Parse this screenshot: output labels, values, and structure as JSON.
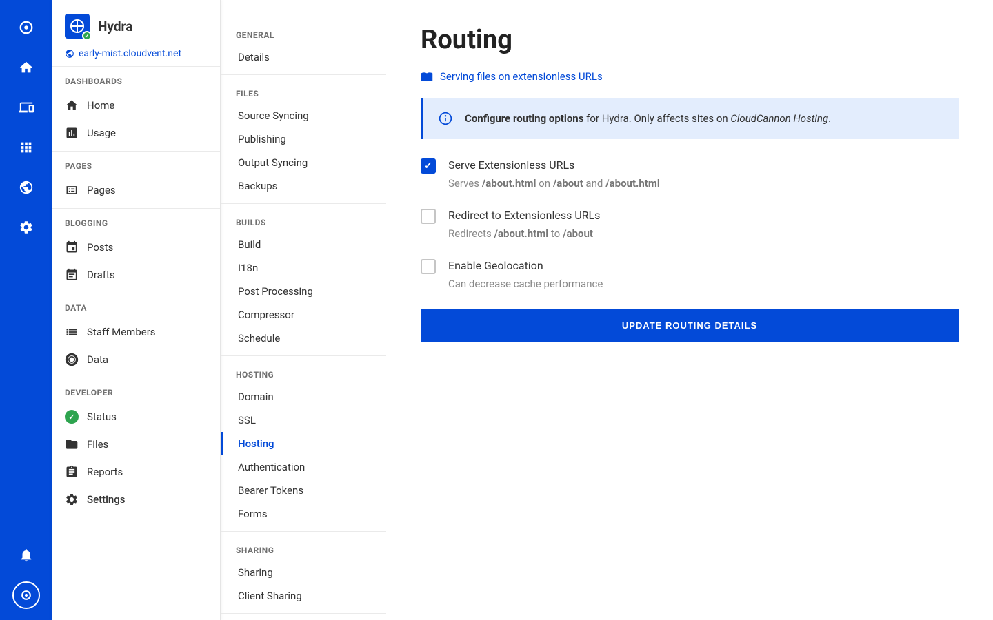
{
  "site": {
    "name": "Hydra",
    "url": "early-mist.cloudvent.net"
  },
  "sidebar": {
    "sections": [
      {
        "header": "DASHBOARDS",
        "items": [
          {
            "label": "Home",
            "icon": "home"
          },
          {
            "label": "Usage",
            "icon": "chart"
          }
        ]
      },
      {
        "header": "PAGES",
        "items": [
          {
            "label": "Pages",
            "icon": "page"
          }
        ]
      },
      {
        "header": "BLOGGING",
        "items": [
          {
            "label": "Posts",
            "icon": "event"
          },
          {
            "label": "Drafts",
            "icon": "event-draft"
          }
        ]
      },
      {
        "header": "DATA",
        "items": [
          {
            "label": "Staff Members",
            "icon": "list"
          },
          {
            "label": "Data",
            "icon": "donut"
          }
        ]
      },
      {
        "header": "DEVELOPER",
        "items": [
          {
            "label": "Status",
            "icon": "status"
          },
          {
            "label": "Files",
            "icon": "folder"
          },
          {
            "label": "Reports",
            "icon": "clipboard"
          },
          {
            "label": "Settings",
            "icon": "gear",
            "active": true
          }
        ]
      }
    ]
  },
  "settings_nav": {
    "groups": [
      {
        "header": "GENERAL",
        "items": [
          "Details"
        ]
      },
      {
        "header": "FILES",
        "items": [
          "Source Syncing",
          "Publishing",
          "Output Syncing",
          "Backups"
        ]
      },
      {
        "header": "BUILDS",
        "items": [
          "Build",
          "I18n",
          "Post Processing",
          "Compressor",
          "Schedule"
        ]
      },
      {
        "header": "HOSTING",
        "items": [
          "Domain",
          "SSL",
          "Hosting",
          "Authentication",
          "Bearer Tokens",
          "Forms"
        ],
        "active": "Hosting"
      },
      {
        "header": "SHARING",
        "items": [
          "Sharing",
          "Client Sharing"
        ]
      }
    ]
  },
  "page": {
    "title": "Routing",
    "doc_link": "Serving files on extensionless URLs",
    "info": {
      "bold": "Configure routing options",
      "rest": " for Hydra. Only affects sites on ",
      "italic": "CloudCannon Hosting",
      "end": "."
    },
    "options": [
      {
        "label": "Serve Extensionless URLs",
        "checked": true,
        "help_pre": "Serves ",
        "help_b1": "/about.html",
        "help_mid1": " on ",
        "help_b2": "/about",
        "help_mid2": " and ",
        "help_b3": "/about.html"
      },
      {
        "label": "Redirect to Extensionless URLs",
        "checked": false,
        "help_pre": "Redirects ",
        "help_b1": "/about.html",
        "help_mid1": " to ",
        "help_b2": "/about"
      },
      {
        "label": "Enable Geolocation",
        "checked": false,
        "help_plain": "Can decrease cache performance"
      }
    ],
    "button": "UPDATE ROUTING DETAILS"
  }
}
